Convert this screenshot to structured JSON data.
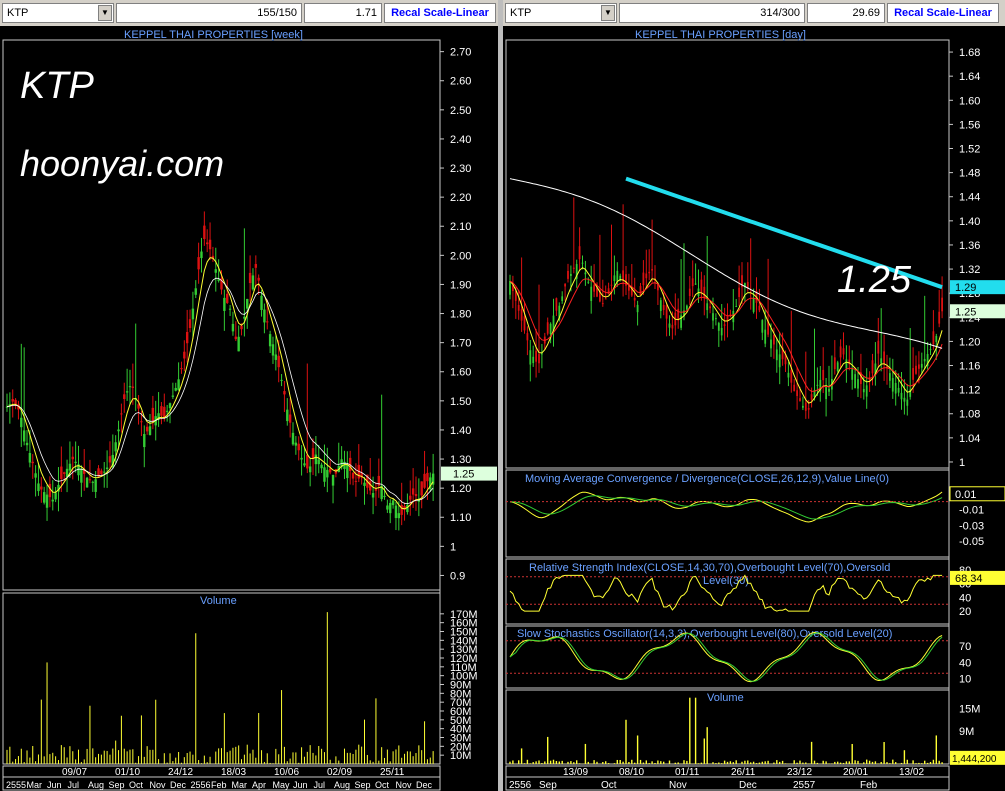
{
  "left": {
    "symbol": "KTP",
    "bars_count": "155/150",
    "metric": "1.71",
    "scale_button": "Recal Scale-Linear",
    "title": "KEPPEL THAI PROPERTIES [week]",
    "overlay_ticker": "KTP",
    "overlay_site": "hoonyai.com",
    "last_price_tag": "1.25",
    "volume_title": "Volume",
    "date_labels": [
      "2555",
      "Mar",
      "Jun",
      "Jul",
      "Aug",
      "Sep",
      "Oct",
      "Nov",
      "Dec",
      "2556",
      "Feb",
      "Mar",
      "Apr",
      "May",
      "Jun",
      "Jul",
      "Aug",
      "Sep",
      "Oct",
      "Nov",
      "Dec"
    ],
    "date_ticks": [
      "09/07",
      "01/10",
      "24/12",
      "18/03",
      "10/06",
      "02/09",
      "25/11"
    ]
  },
  "right": {
    "symbol": "KTP",
    "bars_count": "314/300",
    "metric": "29.69",
    "scale_button": "Recal Scale-Linear",
    "title": "KEPPEL THAI PROPERTIES [day]",
    "annotation": "1.25",
    "ma_tag": "1.29",
    "last_price_tag": "1.25",
    "macd_title": "Moving Average Convergence / Divergence(CLOSE,26,12,9),Value Line(0)",
    "macd_tag": "0.01",
    "rsi_title_1": "Relative Strength Index(CLOSE,14,30,70),Overbought Level(70),Oversold",
    "rsi_title_2": "Level(30)",
    "rsi_tag": "68.34",
    "stoch_title": "Slow Stochastics Oscillator(14,3,3),Overbought Level(80),Oversold Level(20)",
    "volume_title": "Volume",
    "volume_tag": "1,444,200",
    "date_labels": [
      "2556",
      "Sep",
      "Oct",
      "Nov",
      "Dec",
      "2557",
      "Feb"
    ],
    "date_ticks": [
      "13/09",
      "08/10",
      "01/11",
      "26/11",
      "23/12",
      "20/01",
      "13/02"
    ]
  },
  "colors": {
    "up": "#33cc33",
    "down": "#dd1111",
    "ma_short": "#ffff33",
    "ma_mid": "#ff2222",
    "ma_long": "#ffffff",
    "ma_200": "#22ddee",
    "signal": "#33cc33",
    "level": "#cc3333",
    "tag": "#ddffdd"
  },
  "chart_data": [
    {
      "id": "weekly",
      "type": "candlestick",
      "title": "KEPPEL THAI PROPERTIES [week]",
      "y_ticks": [
        "2.70",
        "2.60",
        "2.50",
        "2.40",
        "2.30",
        "2.20",
        "2.10",
        "2.00",
        "1.90",
        "1.80",
        "1.70",
        "1.60",
        "1.50",
        "1.40",
        "1.30",
        "1.20",
        "1.10",
        "1",
        "0.9"
      ],
      "ylim": [
        0.85,
        2.74
      ],
      "approx_close": [
        1.48,
        1.5,
        1.46,
        1.36,
        1.28,
        1.2,
        1.18,
        1.16,
        1.22,
        1.26,
        1.3,
        1.28,
        1.24,
        1.22,
        1.24,
        1.26,
        1.3,
        1.4,
        1.52,
        1.56,
        1.48,
        1.38,
        1.42,
        1.46,
        1.44,
        1.5,
        1.56,
        1.64,
        1.76,
        1.92,
        2.06,
        2.02,
        1.94,
        1.86,
        1.82,
        1.7,
        1.76,
        1.9,
        1.96,
        1.84,
        1.74,
        1.66,
        1.56,
        1.44,
        1.36,
        1.3,
        1.26,
        1.32,
        1.28,
        1.26,
        1.24,
        1.3,
        1.28,
        1.22,
        1.24,
        1.2,
        1.18,
        1.22,
        1.14,
        1.16,
        1.1,
        1.14,
        1.18,
        1.16,
        1.22,
        1.25
      ],
      "volume_ticks": [
        "170M",
        "160M",
        "150M",
        "140M",
        "130M",
        "120M",
        "110M",
        "100M",
        "90M",
        "80M",
        "70M",
        "60M",
        "50M",
        "40M",
        "30M",
        "20M",
        "10M"
      ]
    },
    {
      "id": "daily",
      "type": "candlestick",
      "title": "KEPPEL THAI PROPERTIES [day]",
      "y_ticks": [
        "1.68",
        "1.64",
        "1.60",
        "1.56",
        "1.52",
        "1.48",
        "1.44",
        "1.40",
        "1.36",
        "1.32",
        "1.28",
        "1.24",
        "1.20",
        "1.16",
        "1.12",
        "1.08",
        "1.04",
        "1"
      ],
      "ylim": [
        0.99,
        1.7
      ],
      "approx_close": [
        1.3,
        1.26,
        1.22,
        1.18,
        1.16,
        1.2,
        1.24,
        1.26,
        1.3,
        1.32,
        1.34,
        1.3,
        1.28,
        1.26,
        1.28,
        1.32,
        1.3,
        1.28,
        1.26,
        1.3,
        1.32,
        1.28,
        1.24,
        1.22,
        1.24,
        1.26,
        1.3,
        1.28,
        1.26,
        1.24,
        1.22,
        1.24,
        1.26,
        1.3,
        1.28,
        1.26,
        1.22,
        1.2,
        1.18,
        1.16,
        1.12,
        1.1,
        1.08,
        1.12,
        1.14,
        1.12,
        1.16,
        1.18,
        1.16,
        1.14,
        1.12,
        1.14,
        1.18,
        1.16,
        1.14,
        1.12,
        1.1,
        1.14,
        1.16,
        1.18,
        1.2,
        1.25
      ],
      "ma200_tag": 1.29,
      "macd_ticks": [
        "0.01",
        "-0.01",
        "-0.03",
        "-0.05"
      ],
      "rsi_ticks": [
        "80",
        "60",
        "40",
        "20"
      ],
      "rsi_levels": [
        70,
        30
      ],
      "rsi_last": 68.34,
      "stoch_ticks": [
        "70",
        "40",
        "10"
      ],
      "stoch_levels": [
        80,
        20
      ],
      "volume_ticks": [
        "15M",
        "9M"
      ],
      "volume_last": "1,444,200"
    }
  ]
}
